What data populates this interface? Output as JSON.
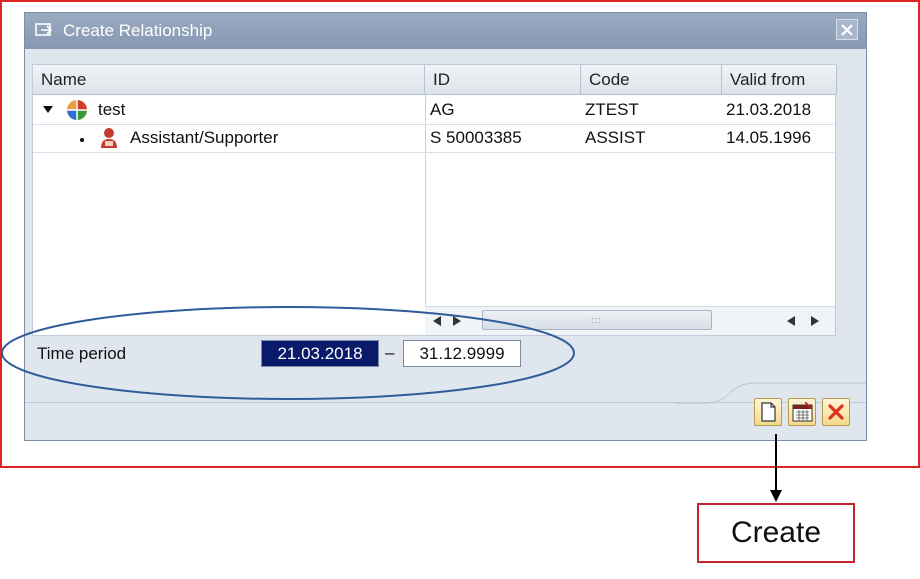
{
  "dialog": {
    "title": "Create Relationship",
    "close_label": ""
  },
  "tree": {
    "columns": [
      "Name",
      "ID",
      "Code",
      "Valid from"
    ],
    "rows": [
      {
        "name": "test",
        "id": "AG",
        "code": "ZTEST",
        "valid_from": "21.03.2018",
        "icon": "org-unit-icon",
        "expander": "expanded-triangle"
      },
      {
        "name": "Assistant/Supporter",
        "id": "S  50003385",
        "code": "ASSIST",
        "valid_from": "14.05.1996",
        "icon": "person-icon",
        "expander": "bullet"
      }
    ]
  },
  "time_period": {
    "label": "Time period",
    "from": "21.03.2018",
    "separator": "–",
    "to": "31.12.9999"
  },
  "toolbar": {
    "buttons": [
      "create-icon",
      "calendar-icon",
      "cancel-icon"
    ]
  },
  "annotation": {
    "callout_text": "Create",
    "callout_color": "#c0262c",
    "frame_color": "#e02424"
  }
}
